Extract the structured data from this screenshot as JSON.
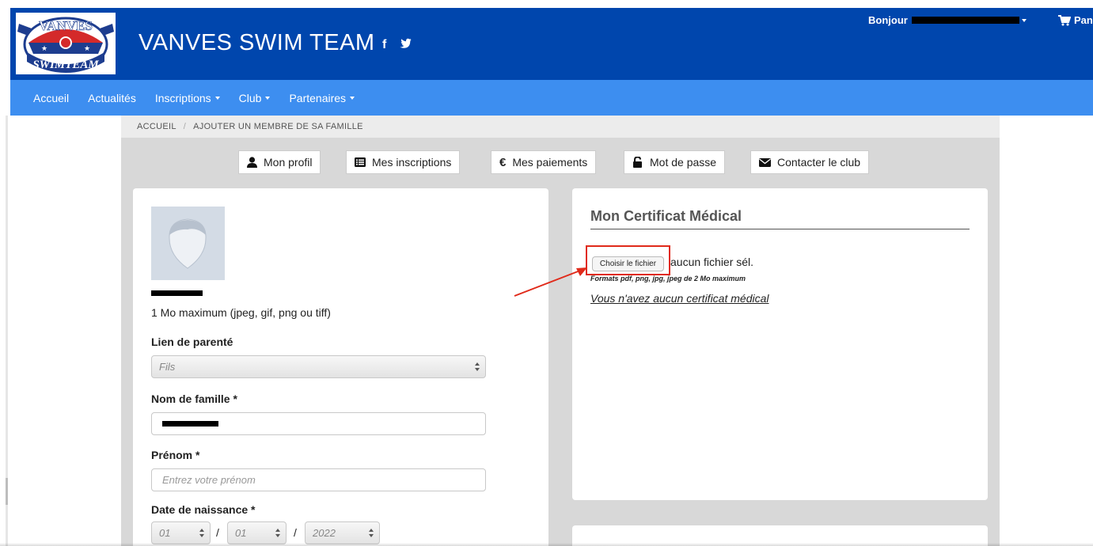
{
  "header": {
    "site_title": "VANVES SWIM TEAM",
    "logo_top": "VANVES",
    "logo_bottom": "SWIMTEAM",
    "social_facebook": "f",
    "greeting": "Bonjour",
    "cart_label": "Panie"
  },
  "nav": {
    "items": [
      {
        "label": "Accueil"
      },
      {
        "label": "Actualités"
      },
      {
        "label": "Inscriptions"
      },
      {
        "label": "Club"
      },
      {
        "label": "Partenaires"
      }
    ]
  },
  "breadcrumb": {
    "home": "ACCUEIL",
    "separator": "/",
    "current": "AJOUTER UN MEMBRE DE SA FAMILLE"
  },
  "tabs": {
    "profile": "Mon profil",
    "registrations": "Mes inscriptions",
    "payments": "Mes paiements",
    "payments_glyph": "€",
    "password": "Mot de passe",
    "contact": "Contacter le club"
  },
  "profile_form": {
    "photo_hint": "1 Mo maximum (jpeg, gif, png ou tiff)",
    "relation_label": "Lien de parenté",
    "relation_value": "Fils",
    "lastname_label": "Nom de famille *",
    "firstname_label": "Prénom *",
    "firstname_placeholder": "Entrez votre prénom",
    "birthdate_label": "Date de naissance *",
    "birth_day": "01",
    "birth_month": "01",
    "birth_year": "2022",
    "date_sep": "/"
  },
  "certificate": {
    "title": "Mon Certificat Médical",
    "choose_file": "Choisir le fichier",
    "no_file": "aucun fichier sél.",
    "formats": "Formats pdf, png, jpg, jpeg de 2 Mo maximum",
    "no_certificate": "Vous n'avez aucun certificat médical"
  },
  "colors": {
    "header_bg": "#0046ad",
    "nav_bg": "#3d8ef0",
    "highlight": "#e02a1a"
  }
}
